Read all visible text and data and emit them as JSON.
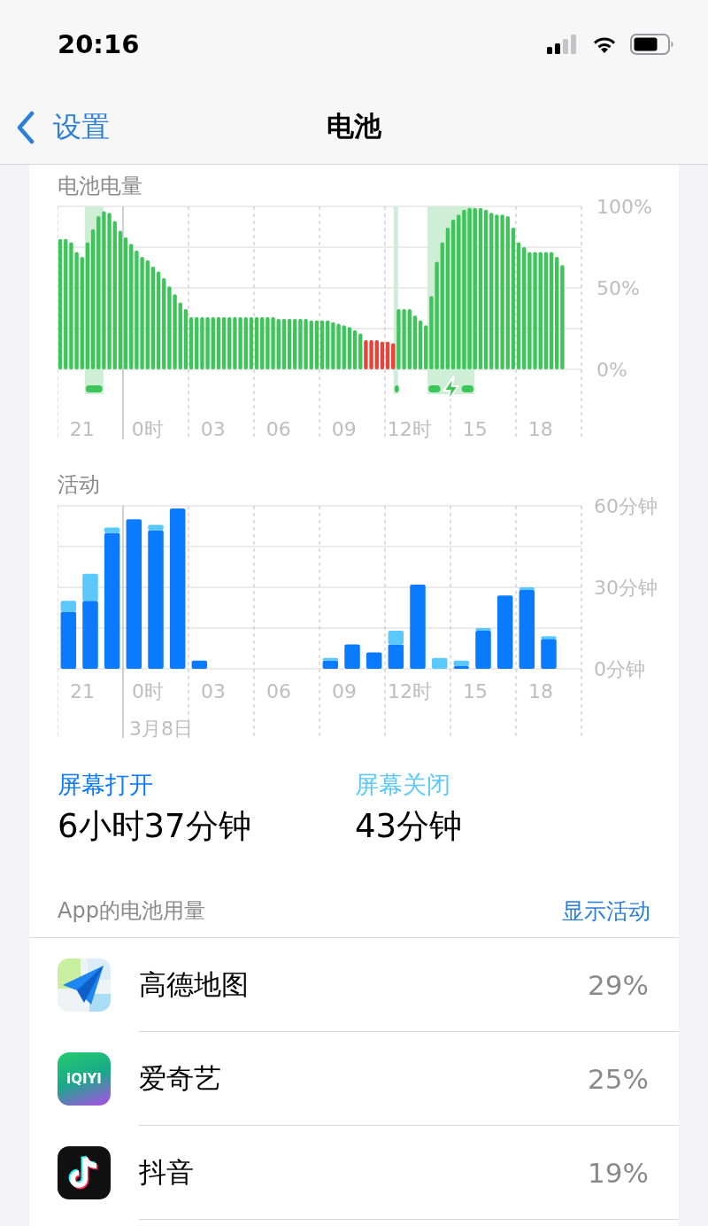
{
  "status_bar": {
    "time": "20:16"
  },
  "nav": {
    "back": "设置",
    "title": "电池"
  },
  "battery": {
    "chart_data": {
      "type": "bar",
      "title": "电池电量",
      "categories": [
        null,
        null,
        null,
        null,
        "21",
        null,
        null,
        null,
        null,
        null,
        null,
        null,
        null,
        null,
        null,
        null,
        "0时",
        null,
        null,
        null,
        null,
        null,
        null,
        null,
        null,
        null,
        null,
        null,
        "03",
        null,
        null,
        null,
        null,
        null,
        null,
        null,
        null,
        null,
        null,
        null,
        "06",
        null,
        null,
        null,
        null,
        null,
        null,
        null,
        null,
        null,
        null,
        null,
        "09",
        null,
        null,
        null,
        null,
        null,
        null,
        null,
        null,
        null,
        null,
        null,
        "12时",
        null,
        null,
        null,
        null,
        null,
        null,
        null,
        null,
        null,
        null,
        null,
        "15",
        null,
        null,
        null,
        null,
        null,
        null,
        null,
        null,
        null,
        null,
        null,
        "18",
        null,
        null,
        null,
        null,
        null,
        null,
        null
      ],
      "values": [
        80,
        80,
        78,
        72,
        69,
        78,
        86,
        94,
        97,
        96,
        91,
        85,
        81,
        77,
        73,
        69,
        67,
        63,
        60,
        56,
        51,
        46,
        41,
        37,
        32,
        32,
        32,
        32,
        32,
        32,
        32,
        32,
        32,
        32,
        32,
        32,
        32,
        32,
        32,
        32,
        31,
        31,
        31,
        31,
        31,
        31,
        30,
        30,
        30,
        30,
        29,
        28,
        27,
        26,
        24,
        22,
        18,
        18,
        18,
        17,
        17,
        16,
        37,
        37,
        37,
        33,
        30,
        27,
        45,
        66,
        78,
        87,
        92,
        95,
        98,
        99,
        99,
        99,
        98,
        96,
        95,
        95,
        94,
        87,
        78,
        75,
        72,
        72,
        72,
        72,
        72,
        69,
        64,
        null,
        null,
        null
      ],
      "ylim": [
        0,
        100
      ],
      "grid": true,
      "yticks": [
        {
          "value": 0,
          "label": "0%"
        },
        {
          "value": 50,
          "label": "50%"
        },
        {
          "value": 100,
          "label": "100%"
        }
      ]
    }
  },
  "activity": {
    "chart_data": {
      "type": "bar",
      "title": "活动",
      "stacked": true,
      "categories": [
        null,
        "21",
        null,
        null,
        "0时",
        null,
        null,
        "03",
        null,
        null,
        "06",
        null,
        null,
        "09",
        null,
        null,
        "12时",
        null,
        null,
        "15",
        null,
        null,
        "18",
        null
      ],
      "series": [
        {
          "name": "屏幕打开",
          "color": "#0a7aff",
          "values": [
            21,
            25,
            50,
            55,
            51,
            59,
            3,
            0,
            0,
            0,
            0,
            0,
            3,
            9,
            6,
            9,
            31,
            0,
            1,
            14,
            27,
            29,
            11,
            null
          ]
        },
        {
          "name": "屏幕关闭",
          "color": "#5ac8fa",
          "values": [
            4,
            10,
            2,
            0,
            2,
            0,
            0,
            0,
            0,
            0,
            0,
            0,
            1,
            0,
            0,
            5,
            0,
            4,
            2,
            1,
            0,
            1,
            1,
            null
          ]
        }
      ],
      "ylim": [
        0,
        60
      ],
      "grid": true,
      "yticks": [
        {
          "value": 0,
          "label": "0分钟"
        },
        {
          "value": 30,
          "label": "30分钟"
        },
        {
          "value": 60,
          "label": "60分钟"
        }
      ],
      "annotations": [
        "3月8日"
      ]
    }
  },
  "summary": [
    {
      "value": "6小时37分钟"
    },
    {
      "value": "43分钟"
    }
  ],
  "apps_header": {
    "label": "App的电池用量",
    "action": "显示活动"
  },
  "apps": [
    {
      "kind": "map",
      "name": "高德地图",
      "percent": "29%"
    },
    {
      "kind": "video",
      "name": "爱奇艺",
      "percent": "25%",
      "logo_text": "iQIYI"
    },
    {
      "kind": "music",
      "name": "抖音",
      "percent": "19%"
    }
  ]
}
